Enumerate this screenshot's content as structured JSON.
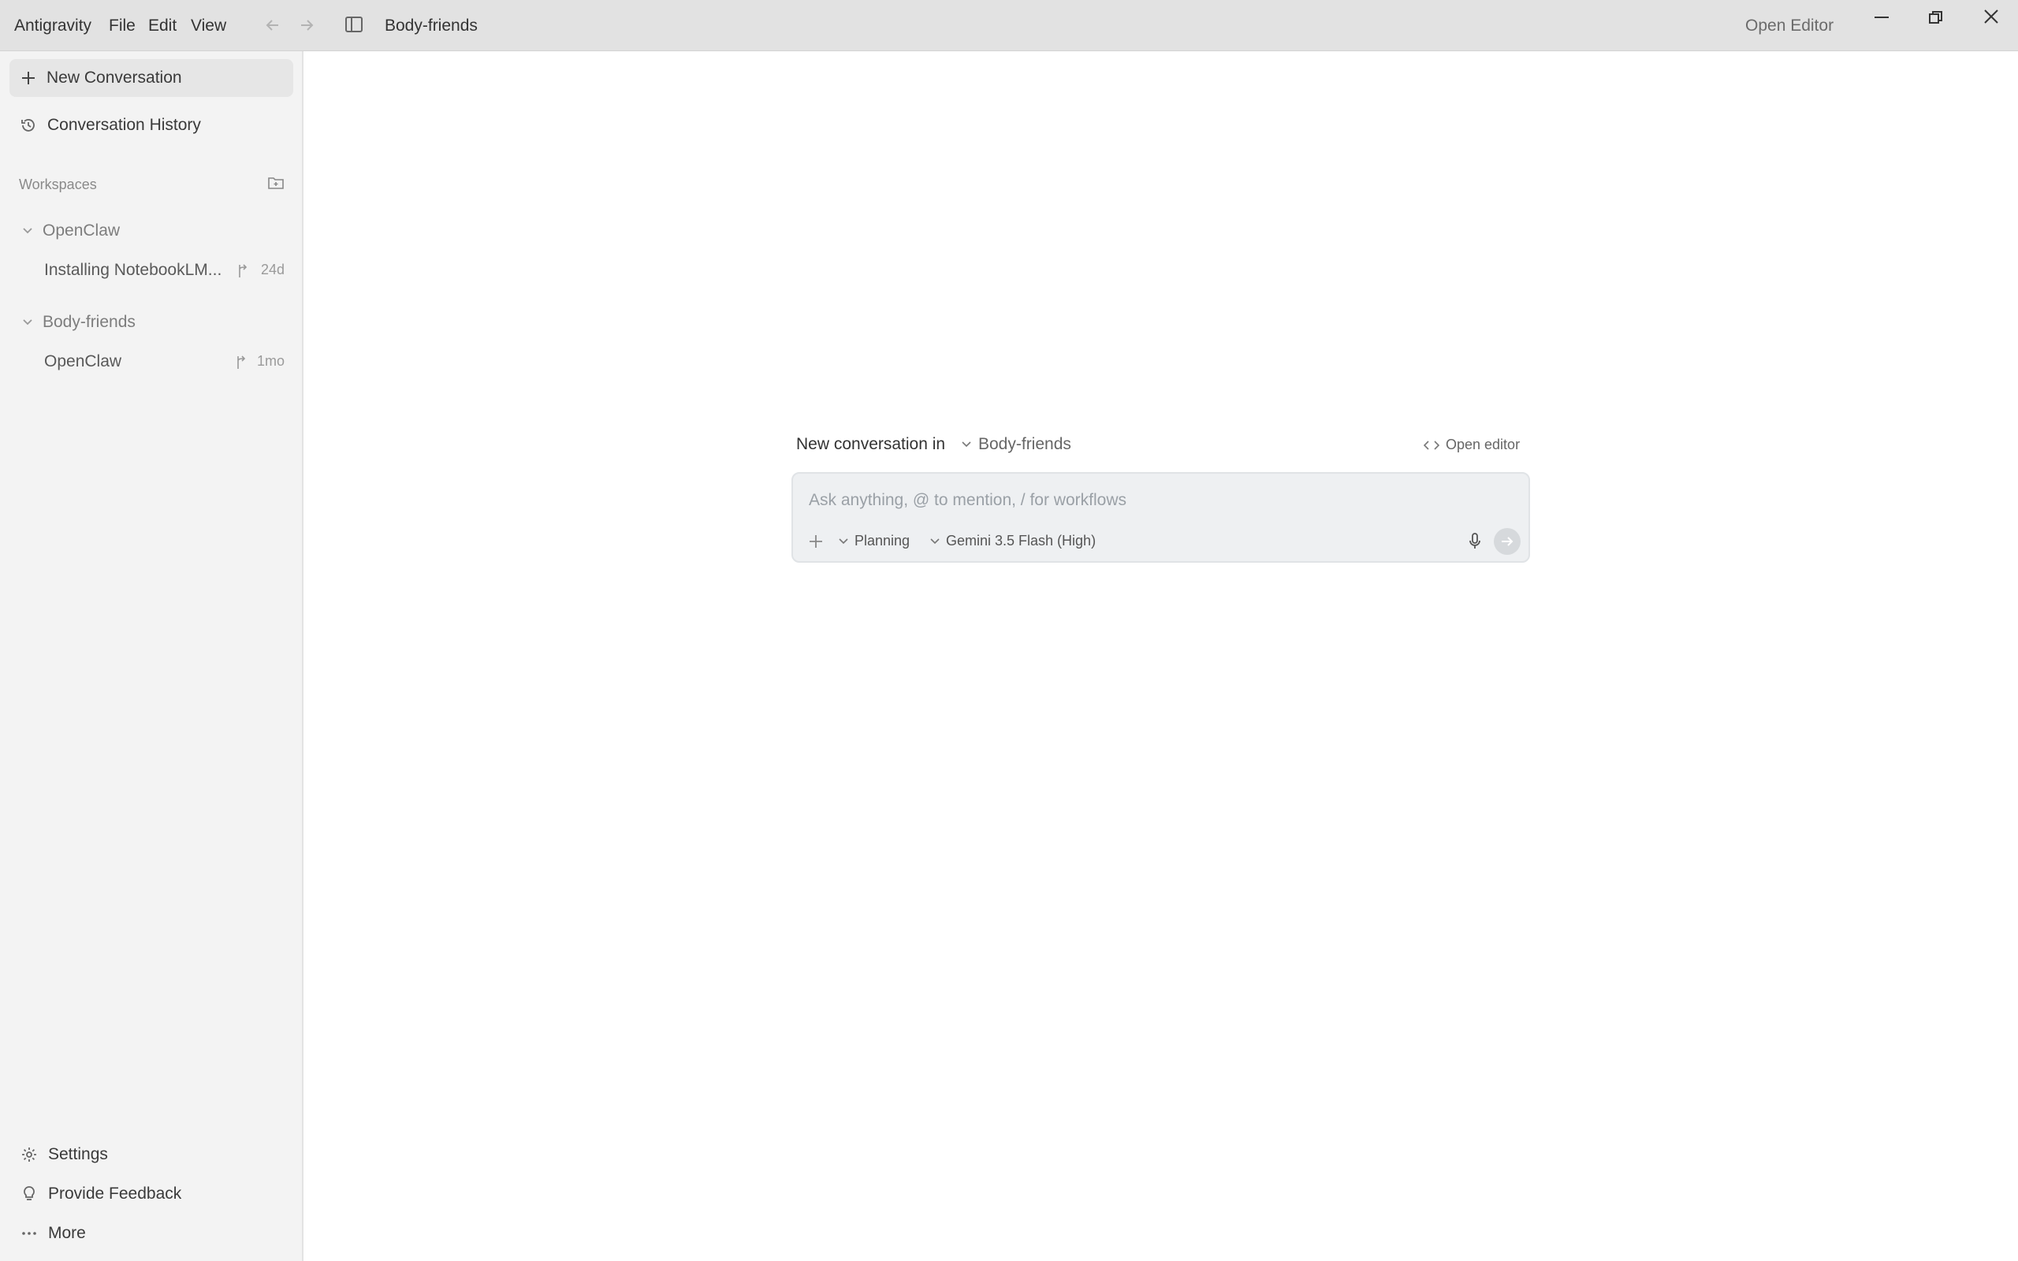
{
  "titlebar": {
    "app_name": "Antigravity",
    "menu": [
      "File",
      "Edit",
      "View"
    ],
    "window_title": "Body-friends",
    "open_editor": "Open Editor"
  },
  "sidebar": {
    "new_conversation": "New Conversation",
    "conversation_history": "Conversation History",
    "workspaces_label": "Workspaces",
    "workspaces": [
      {
        "name": "OpenClaw",
        "conversations": [
          {
            "title": "Installing NotebookLM...",
            "age": "24d"
          }
        ]
      },
      {
        "name": "Body-friends",
        "conversations": [
          {
            "title": "OpenClaw",
            "age": "1mo"
          }
        ]
      }
    ],
    "footer": {
      "settings": "Settings",
      "feedback": "Provide Feedback",
      "more": "More"
    }
  },
  "main": {
    "new_conversation_in": "New conversation in",
    "workspace": "Body-friends",
    "open_editor": "Open editor",
    "input_placeholder": "Ask anything, @ to mention, / for workflows",
    "mode": "Planning",
    "model": "Gemini 3.5 Flash (High)"
  },
  "colors": {
    "titlebar_bg": "#e2e2e2",
    "sidebar_bg": "#f3f3f3",
    "composer_bg": "#eef0f2"
  }
}
